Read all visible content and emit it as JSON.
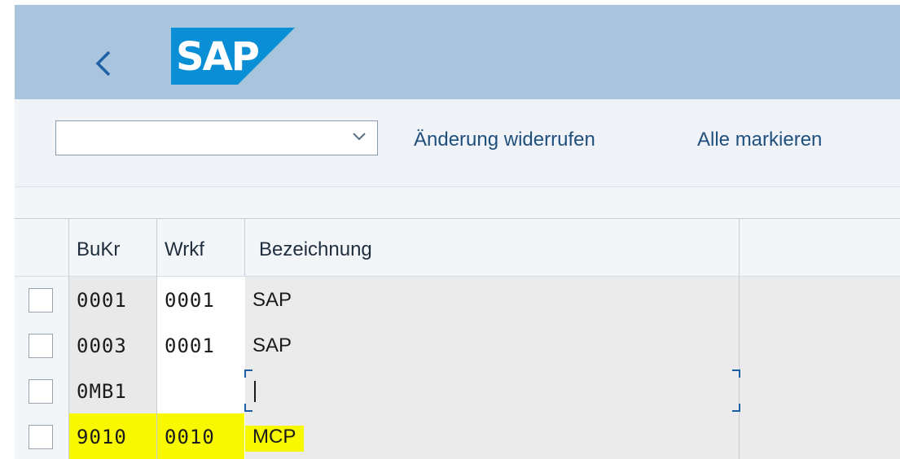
{
  "header": {
    "logo_text": "SAP",
    "brand_color": "#0a8fd6",
    "back_icon": "chevron-left-icon"
  },
  "toolbar": {
    "dropdown_value": "",
    "undo_label": "Änderung widerrufen",
    "select_all_label": "Alle markieren"
  },
  "table": {
    "columns": [
      "BuKr",
      "Wrkf",
      "Bezeichnung"
    ],
    "rows": [
      {
        "bukr": "0001",
        "wrkf": "0001",
        "bez": "SAP"
      },
      {
        "bukr": "0003",
        "wrkf": "0001",
        "bez": "SAP"
      },
      {
        "bukr": "0MB1",
        "wrkf": "",
        "bez": ""
      },
      {
        "bukr": "9010",
        "wrkf": "0010",
        "bez": "MCP"
      }
    ],
    "highlight_color": "#f8f800"
  }
}
